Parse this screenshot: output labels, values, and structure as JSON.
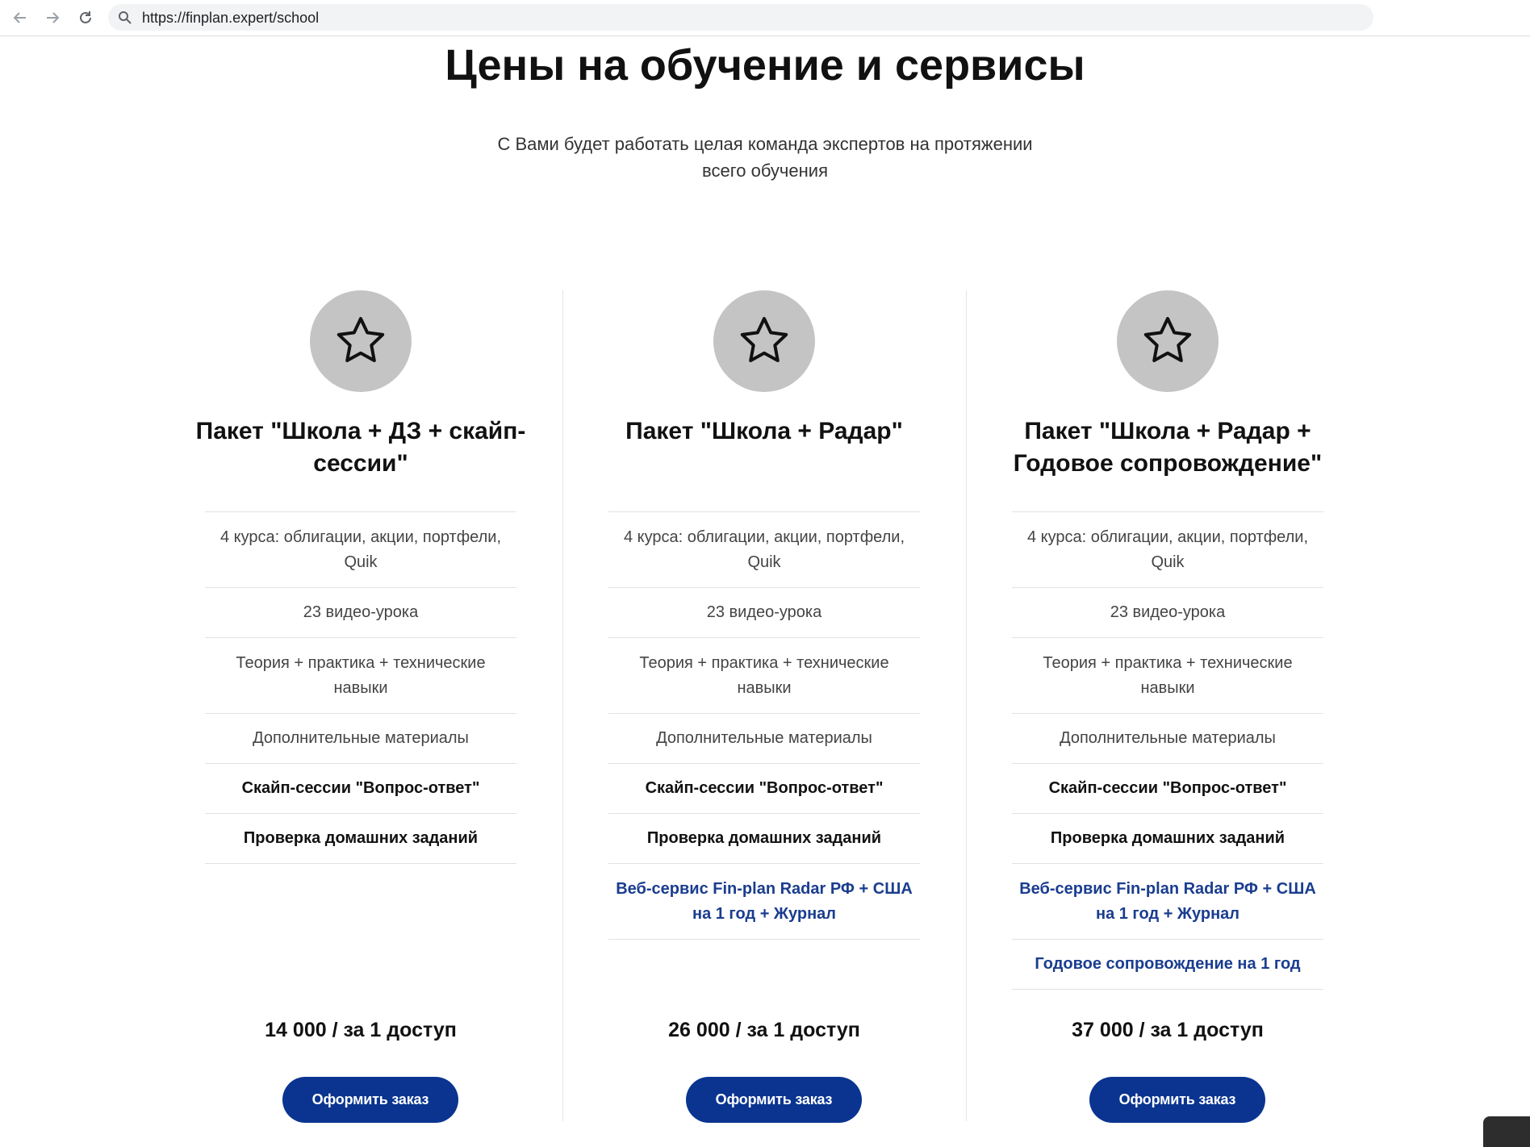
{
  "browser": {
    "url": "https://finplan.expert/school"
  },
  "page": {
    "title": "Цены на обучение и сервисы",
    "subtitle": "С Вами будет работать целая команда экспертов на протяжении всего обучения"
  },
  "plans": [
    {
      "title": "Пакет \"Школа + ДЗ + скайп-сессии\"",
      "features": [
        "4 курса: облигации, акции, портфели, Quik",
        "23 видео-урока",
        "Теория + практика + технические навыки",
        "Дополнительные материалы",
        "Скайп-сессии \"Вопрос-ответ\"",
        "Проверка домашних заданий"
      ],
      "price": "14 000 / за 1 доступ",
      "button": "Оформить заказ"
    },
    {
      "title": "Пакет \"Школа + Радар\"",
      "features": [
        "4 курса: облигации, акции, портфели, Quik",
        "23 видео-урока",
        "Теория + практика + технические навыки",
        "Дополнительные материалы",
        "Скайп-сессии \"Вопрос-ответ\"",
        "Проверка домашних заданий",
        "Веб-сервис Fin-plan Radar РФ + США на 1 год + Журнал"
      ],
      "price": "26 000 / за 1 доступ",
      "button": "Оформить заказ"
    },
    {
      "title": "Пакет \"Школа + Радар + Годовое сопровождение\"",
      "features": [
        "4 курса: облигации, акции, портфели, Quik",
        "23 видео-урока",
        "Теория + практика + технические навыки",
        "Дополнительные материалы",
        "Скайп-сессии \"Вопрос-ответ\"",
        "Проверка домашних заданий",
        "Веб-сервис Fin-plan Radar РФ + США на 1 год + Журнал",
        "Годовое сопровождение на 1 год"
      ],
      "price": "37 000 / за 1 доступ",
      "button": "Оформить заказ"
    }
  ],
  "icons": {
    "plan_icon": "star-icon",
    "back": "arrow-left-icon",
    "forward": "arrow-right-icon",
    "reload": "reload-icon",
    "search": "search-icon"
  },
  "colors": {
    "accent": "#0a3490",
    "link_text": "#1a3d8f",
    "icon_circle": "#c4c4c4"
  }
}
